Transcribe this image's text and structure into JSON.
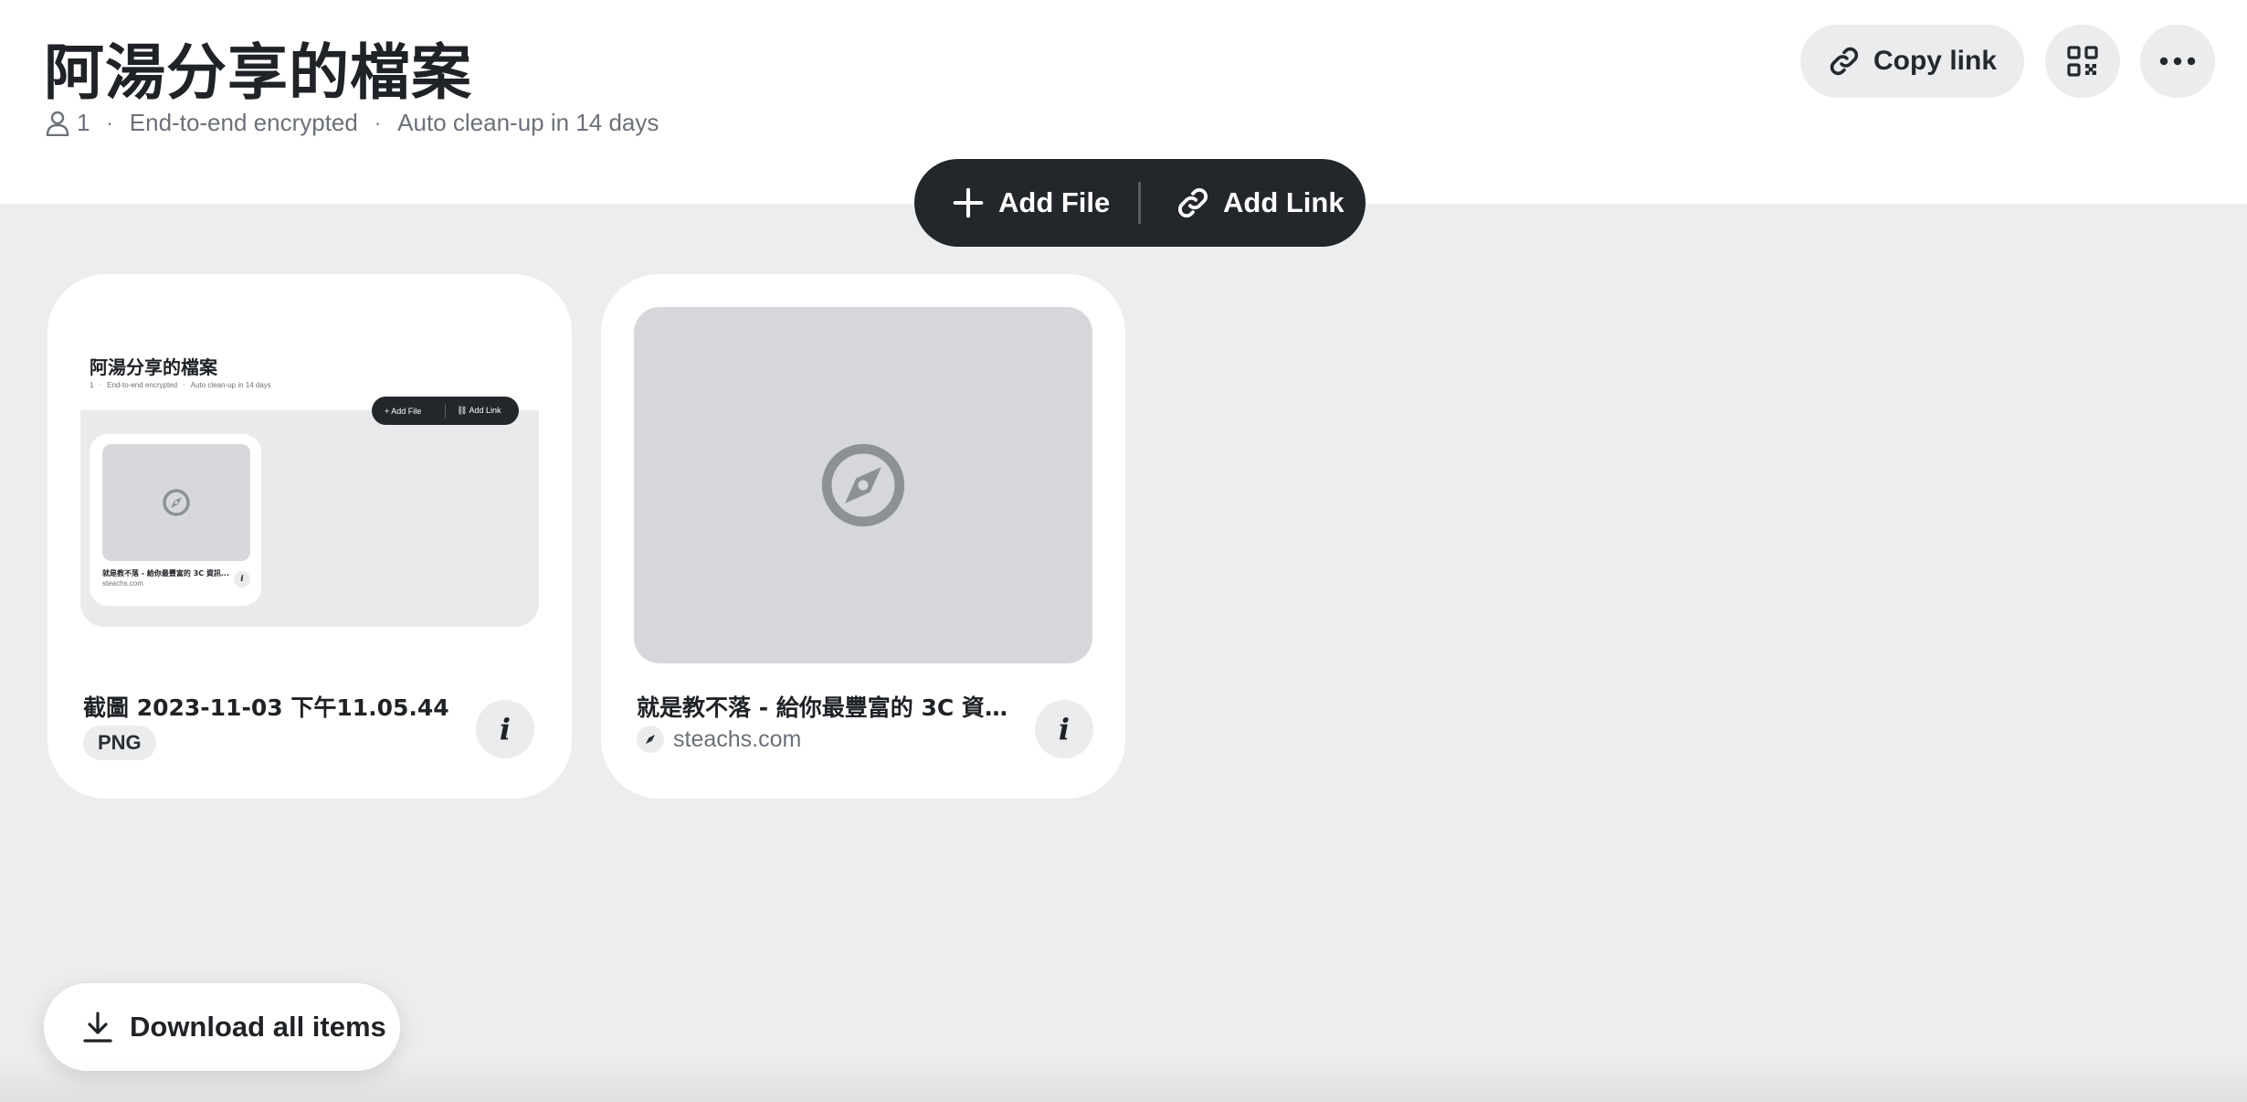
{
  "header": {
    "title": "阿湯分享的檔案",
    "member_count": "1",
    "encryption": "End-to-end encrypted",
    "cleanup": "Auto clean-up in 14 days",
    "separator": "·",
    "copy_link_label": "Copy link",
    "qr_icon": "qr-code-icon",
    "more_icon": "more-icon"
  },
  "actions": {
    "add_file_label": "Add File",
    "add_link_label": "Add Link"
  },
  "items": [
    {
      "title": "截圖 2023-11-03 下午11.05.44",
      "type_badge": "PNG",
      "info_label": "i",
      "preview": {
        "title": "阿湯分享的檔案",
        "member_count": "1",
        "encryption": "End-to-end encrypted",
        "cleanup": "Auto clean-up in 14 days",
        "add_file_label": "Add File",
        "add_link_label": "Add Link",
        "card_title": "就是教不落 - 給你最豐富的 3C 資訊...",
        "card_domain": "steachs.com",
        "card_info": "i"
      }
    },
    {
      "title": "就是教不落 - 給你最豐富的 3C 資訊...",
      "domain": "steachs.com",
      "info_label": "i",
      "icon": "compass-icon"
    }
  ],
  "footer": {
    "download_all_label": "Download all items"
  },
  "colors": {
    "background": "#ecedef",
    "surface": "#ffffff",
    "dark_pill": "#23262a",
    "muted_text": "#6b7079",
    "chip": "#ebecee",
    "placeholder": "#d5d7da"
  }
}
